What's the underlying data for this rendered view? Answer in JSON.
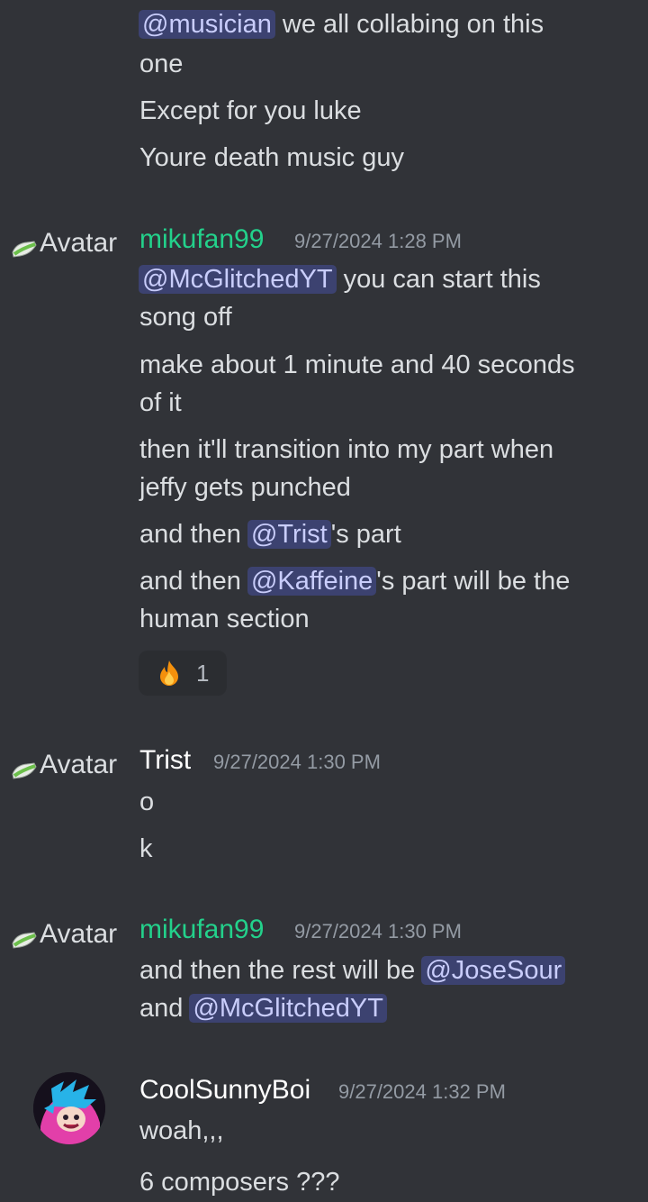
{
  "colors": {
    "background": "#313338",
    "text": "#dbdee1",
    "timestamp": "#949ba4",
    "mention_bg": "#3c4270",
    "mention_text": "#c9cdfb",
    "mikufan_color": "#23d18b",
    "trist_color": "#ffffff",
    "reaction_bg": "#2b2d31"
  },
  "avatar_alt": "Avatar",
  "messages": {
    "top": {
      "line1_mention": "@musician",
      "line1_text": " we all collabing on this",
      "line1b": "one",
      "line2": "Except for you luke",
      "line3": "Youre death music guy"
    },
    "m1": {
      "username": "mikufan99",
      "timestamp": "9/27/2024 1:28 PM",
      "l1_mention": "@McGlitchedYT",
      "l1_text": " you can start this",
      "l1b": "song off",
      "l2a": "make about 1 minute and 40 seconds",
      "l2b": "of it",
      "l3a": "then it'll transition into my part when",
      "l3b": "jeffy gets punched",
      "l4_pre": "and then ",
      "l4_mention": "@Trist",
      "l4_post": "'s part",
      "l5_pre": "and then ",
      "l5_mention": "@Kaffeine",
      "l5_post": "'s part will be the",
      "l5b": "human section",
      "reaction_icon": "fire-emoji",
      "reaction_count": "1"
    },
    "m2": {
      "username": "Trist",
      "timestamp": "9/27/2024 1:30 PM",
      "l1": "o",
      "l2": "k"
    },
    "m3": {
      "username": "mikufan99",
      "timestamp": "9/27/2024 1:30 PM",
      "l1_pre": "and then the rest will be ",
      "l1_mention": "@JoseSour",
      "l2_pre": "and ",
      "l2_mention": "@McGlitchedYT"
    },
    "m4": {
      "username": "CoolSunnyBoi",
      "timestamp": "9/27/2024 1:32 PM",
      "l1": "woah,,,",
      "l2": "6 composers ???"
    }
  }
}
